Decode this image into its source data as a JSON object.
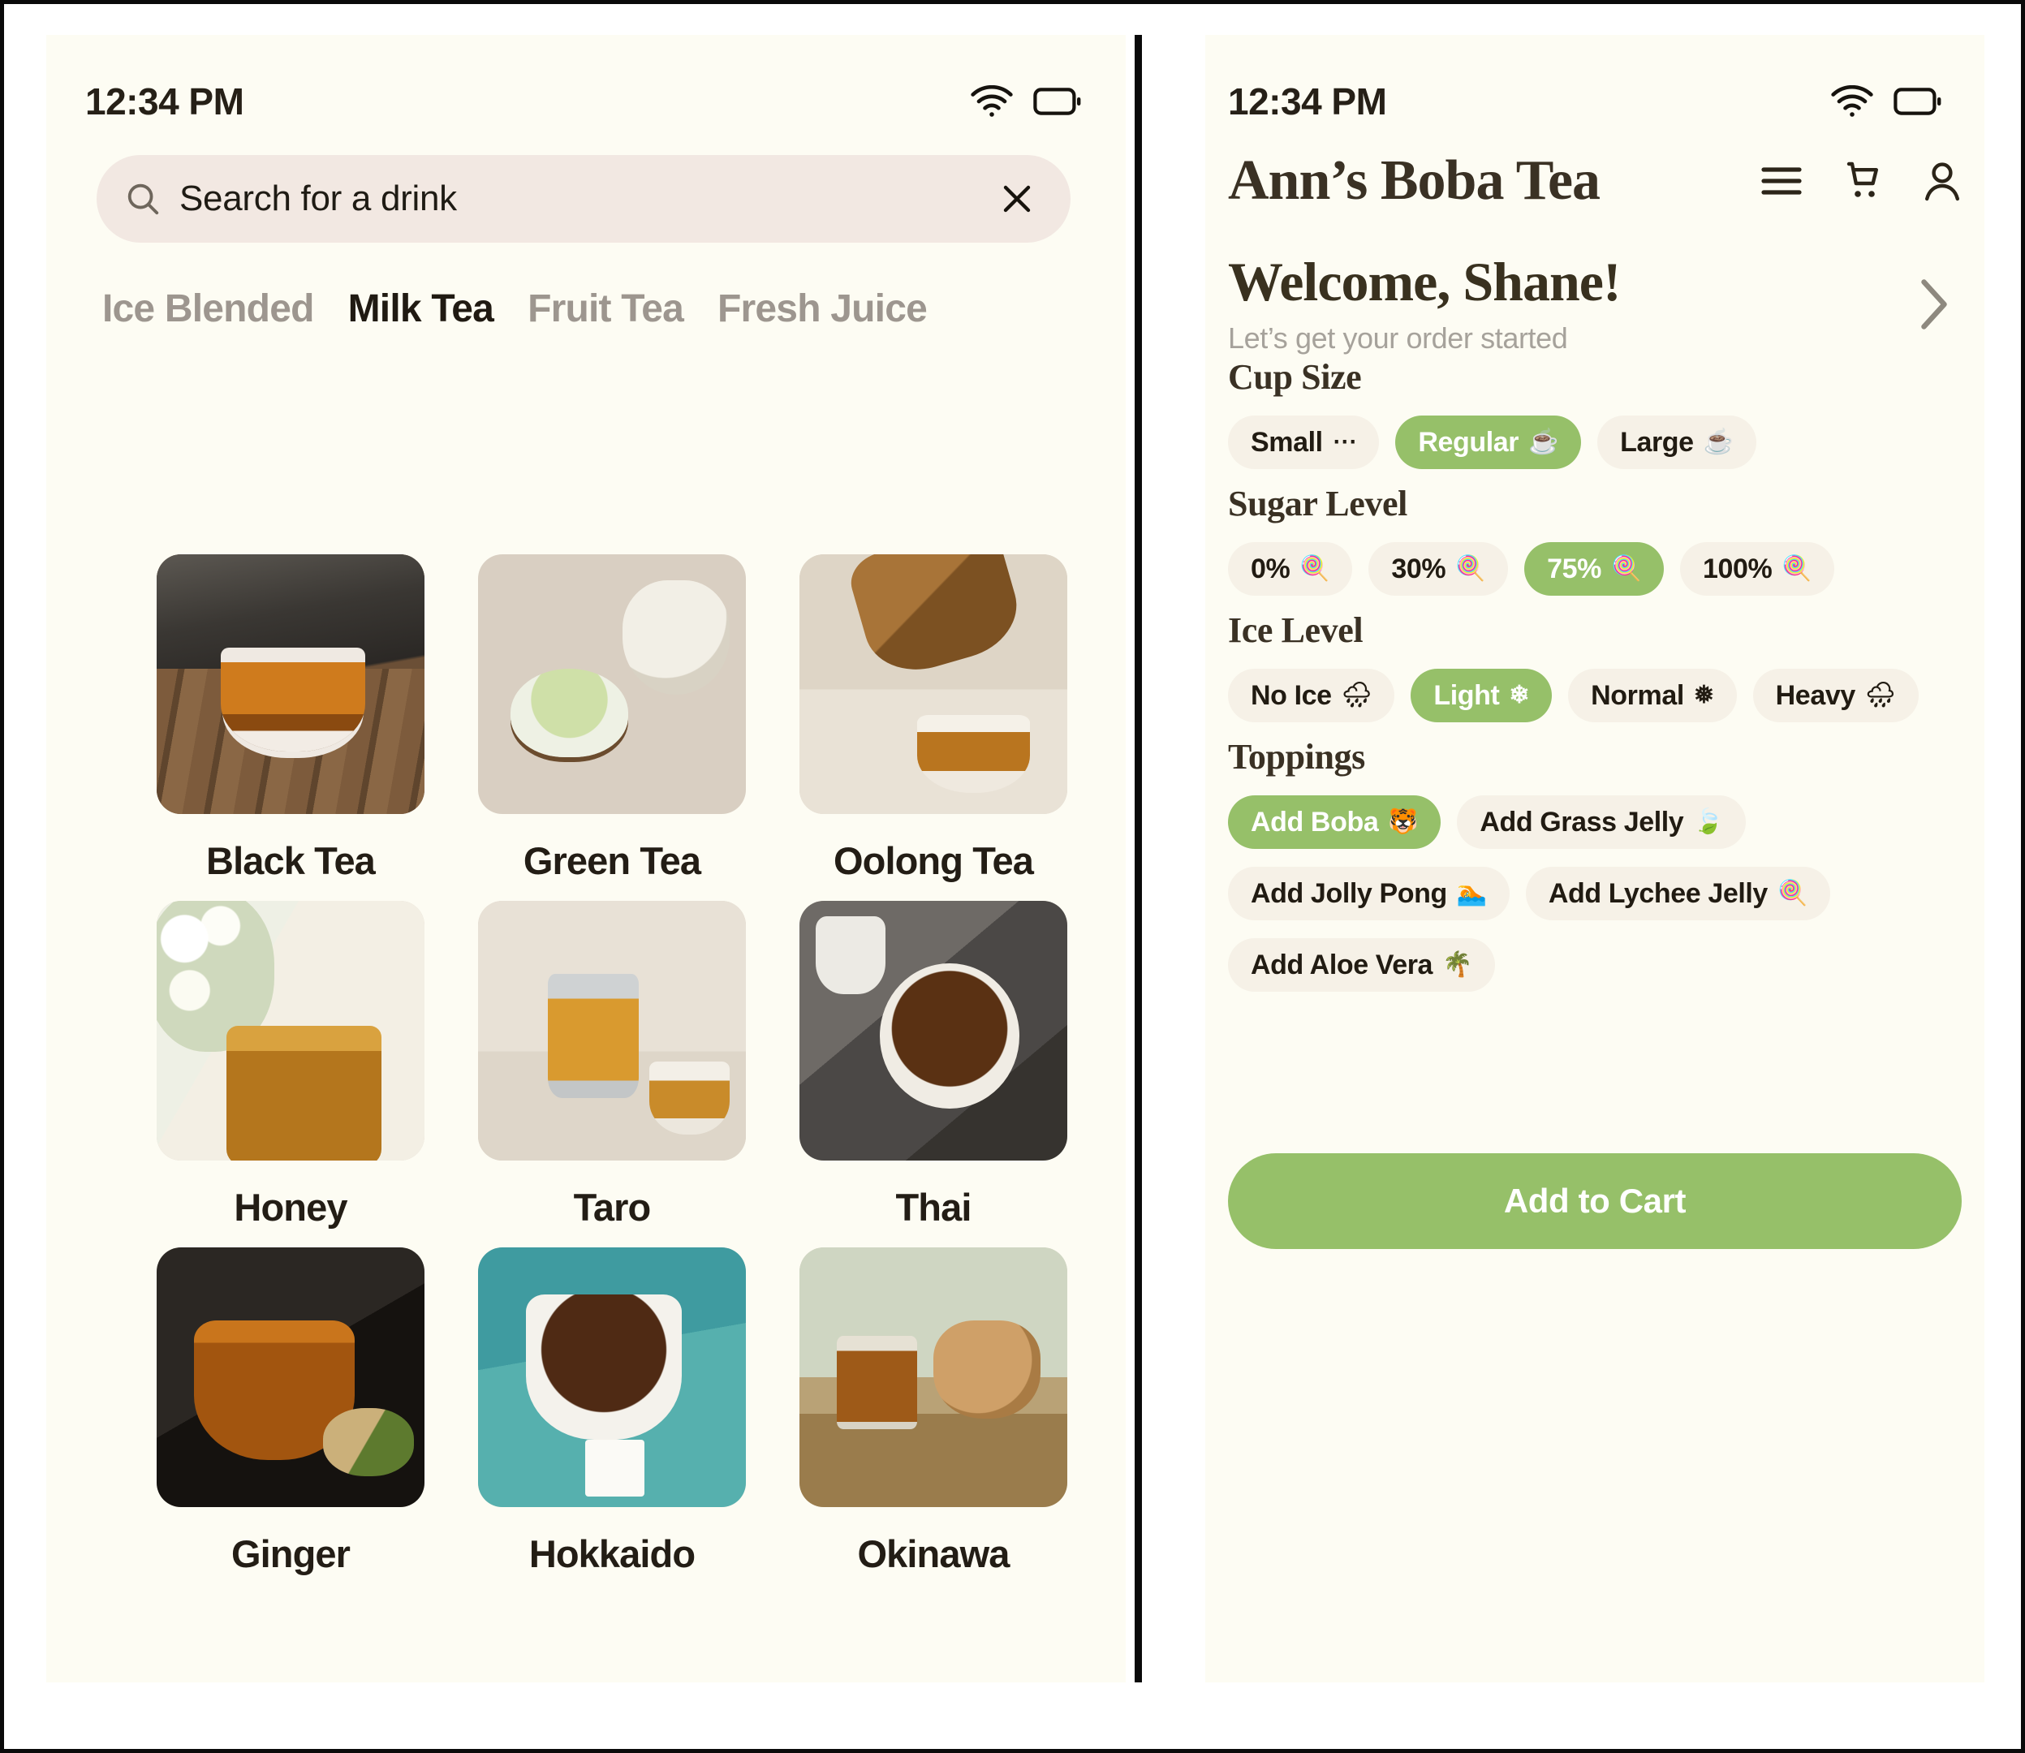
{
  "left_phone": {
    "status": {
      "time": "12:34 PM",
      "wifi_icon": "wifi-icon",
      "battery_icon": "battery-icon"
    },
    "search": {
      "placeholder": "Search for a drink",
      "value": "",
      "search_icon": "search-icon",
      "clear_icon": "close-icon"
    },
    "tabs": [
      {
        "label": "Ice Blended",
        "active": false
      },
      {
        "label": "Milk Tea",
        "active": true
      },
      {
        "label": "Fruit Tea",
        "active": false
      },
      {
        "label": "Fresh Juice",
        "active": false
      }
    ],
    "grid": [
      {
        "label": "Black Tea",
        "image": "steaming-black-tea-cup-on-wood-table"
      },
      {
        "label": "Green Tea",
        "image": "green-tea-bowl-with-teapot"
      },
      {
        "label": "Oolong Tea",
        "image": "pouring-oolong-tea-on-linen"
      },
      {
        "label": "Honey",
        "image": "honey-jar-with-dipper-and-flowers"
      },
      {
        "label": "Taro",
        "image": "glass-teapot-and-cup-on-plaster-wall"
      },
      {
        "label": "Thai",
        "image": "thai-tea-mug-on-metal-tray"
      },
      {
        "label": "Ginger",
        "image": "ginger-tea-bowl-with-roots"
      },
      {
        "label": "Hokkaido",
        "image": "white-cup-with-tea-bag-on-teal"
      },
      {
        "label": "Okinawa",
        "image": "glass-cup-and-clay-teapot-on-wood"
      }
    ]
  },
  "right_phone": {
    "status": {
      "time": "12:34 PM",
      "wifi_icon": "wifi-icon",
      "battery_icon": "battery-icon"
    },
    "brand": {
      "title": "Ann’s Boba Tea",
      "menu_icon": "hamburger-menu-icon",
      "cart_icon": "shopping-cart-icon",
      "account_icon": "user-account-icon"
    },
    "welcome": {
      "title": "Welcome, Shane!",
      "subtitle": "Let’s get your order started",
      "chevron_icon": "chevron-right-icon"
    },
    "sections": {
      "cup_size": {
        "title": "Cup Size",
        "options": [
          {
            "label": "Small",
            "icon": "⋯",
            "icon_name": "ellipsis-icon",
            "selected": false
          },
          {
            "label": "Regular",
            "icon": "☕",
            "icon_name": "hot-beverage-icon",
            "selected": true
          },
          {
            "label": "Large",
            "icon": "☕",
            "icon_name": "hot-beverage-icon",
            "selected": false
          }
        ]
      },
      "sugar_level": {
        "title": "Sugar Level",
        "options": [
          {
            "label": "0%",
            "icon": "🍭",
            "icon_name": "lollipop-icon",
            "selected": false
          },
          {
            "label": "30%",
            "icon": "🍭",
            "icon_name": "lollipop-icon",
            "selected": false
          },
          {
            "label": "75%",
            "icon": "🍭",
            "icon_name": "lollipop-icon",
            "selected": true
          },
          {
            "label": "100%",
            "icon": "🍭",
            "icon_name": "lollipop-icon",
            "selected": false
          }
        ]
      },
      "ice_level": {
        "title": "Ice Level",
        "options": [
          {
            "label": "No Ice",
            "icon": "🌧",
            "icon_name": "rain-cloud-icon",
            "selected": false
          },
          {
            "label": "Light",
            "icon": "❄",
            "icon_name": "snowflake-icon",
            "selected": true
          },
          {
            "label": "Normal",
            "icon": "❅",
            "icon_name": "snowflake-icon",
            "selected": false
          },
          {
            "label": "Heavy",
            "icon": "🌧",
            "icon_name": "rain-cloud-icon",
            "selected": false
          }
        ]
      },
      "toppings": {
        "title": "Toppings",
        "options": [
          {
            "label": "Add Boba",
            "icon": "🐯",
            "icon_name": "tiger-face-icon",
            "selected": true
          },
          {
            "label": "Add Grass Jelly",
            "icon": "🍃",
            "icon_name": "leaf-icon",
            "selected": false
          },
          {
            "label": "Add Jolly Pong",
            "icon": "🏊",
            "icon_name": "swimmer-icon",
            "selected": false
          },
          {
            "label": "Add Lychee Jelly",
            "icon": "🍭",
            "icon_name": "lollipop-icon",
            "selected": false
          },
          {
            "label": "Add Aloe Vera",
            "icon": "🌴",
            "icon_name": "palm-tree-icon",
            "selected": false
          }
        ]
      }
    },
    "add_to_cart_label": "Add to Cart"
  },
  "colors": {
    "panel_bg": "#fdfcf3",
    "search_bg": "#f2e8e2",
    "chip_bg": "#f6f1e7",
    "accent_green": "#96c069",
    "text_dark": "#231d15",
    "text_muted": "#9d968f"
  }
}
